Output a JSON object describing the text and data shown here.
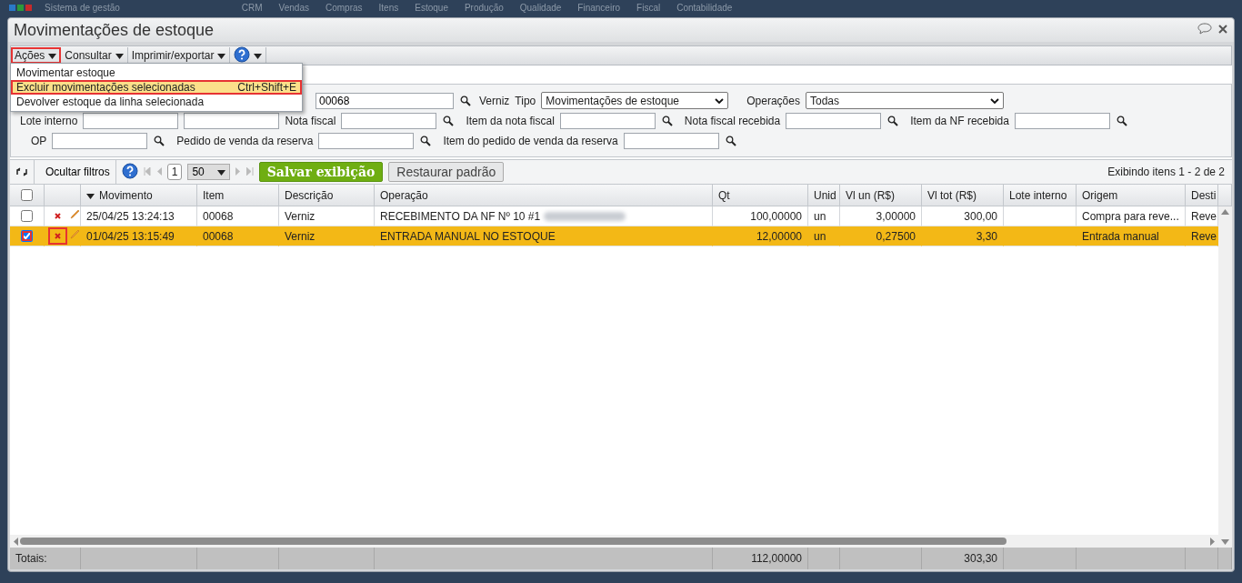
{
  "app": {
    "title": "Sistema de gestão",
    "menus": [
      "CRM",
      "Vendas",
      "Compras",
      "Itens",
      "Estoque",
      "Produção",
      "Qualidade",
      "Financeiro",
      "Fiscal",
      "Contabilidade"
    ]
  },
  "window": {
    "title": "Movimentações de estoque"
  },
  "toolbar": [
    {
      "kind": "menu",
      "label": "Ações",
      "highlighted": true,
      "expanded": true
    },
    {
      "kind": "menu",
      "label": "Consultar",
      "highlighted": false,
      "expanded": false
    },
    {
      "kind": "menu",
      "label": "Imprimir/exportar",
      "highlighted": false,
      "expanded": false
    },
    {
      "kind": "help",
      "highlighted": false,
      "expanded": false
    }
  ],
  "menu": [
    {
      "label": "Movimentar estoque",
      "selected": false,
      "highlighted": false
    },
    {
      "label": "Excluir movimentações selecionadas",
      "shortcut": "Ctrl+Shift+E",
      "selected": true,
      "highlighted": true
    },
    {
      "label": "Devolver estoque da linha selecionada",
      "selected": false,
      "highlighted": false
    }
  ],
  "filters": [
    [
      {
        "kind": "field",
        "value": "00068",
        "lookup": true,
        "hint": "Verniz"
      },
      {
        "kind": "select",
        "label": "Tipo",
        "value": "Movimentações de estoque"
      },
      {
        "kind": "select",
        "label": "Operações",
        "value": "Todas"
      }
    ],
    [
      {
        "kind": "field",
        "label": "Lote interno",
        "lookup": false
      },
      {
        "kind": "field",
        "lookup": false
      },
      {
        "kind": "field",
        "label": "Nota fiscal",
        "lookup": true
      },
      {
        "kind": "field",
        "label": "Item da nota fiscal",
        "lookup": true
      },
      {
        "kind": "field",
        "label": "Nota fiscal recebida",
        "lookup": true
      },
      {
        "kind": "field",
        "label": "Item da NF recebida",
        "lookup": true
      }
    ],
    [
      {
        "kind": "field",
        "label": "OP",
        "lookup": true
      },
      {
        "kind": "field",
        "label": "Pedido de venda da reserva",
        "lookup": true
      },
      {
        "kind": "field",
        "label": "Item do pedido de venda da reserva",
        "lookup": true
      }
    ]
  ],
  "grid_toolbar": {
    "hide_filters": "Ocultar filtros",
    "page": "1",
    "page_size": "50",
    "save": "Salvar exibição",
    "restore": "Restaurar padrão",
    "status": "Exibindo itens 1 - 2 de 2"
  },
  "select_all": {
    "checked": false
  },
  "columns": [
    {
      "label": "Movimento",
      "kind": "text",
      "sorted": true
    },
    {
      "label": "Item",
      "kind": "text",
      "sorted": false
    },
    {
      "label": "Descrição",
      "kind": "text",
      "sorted": false
    },
    {
      "label": "Operação",
      "kind": "text",
      "sorted": false
    },
    {
      "label": "Qt",
      "kind": "number",
      "sorted": false
    },
    {
      "label": "Unid",
      "kind": "text",
      "sorted": false
    },
    {
      "label": "Vl un (R$)",
      "kind": "number",
      "sorted": false
    },
    {
      "label": "Vl tot (R$)",
      "kind": "number",
      "sorted": false
    },
    {
      "label": "Lote interno",
      "kind": "text",
      "sorted": false
    },
    {
      "label": "Origem",
      "kind": "text",
      "sorted": false
    },
    {
      "label": "Desti",
      "kind": "text",
      "sorted": false
    }
  ],
  "rows": [
    {
      "checked": false,
      "selected": false,
      "marked": false,
      "redacted": true,
      "cells": [
        "25/04/25 13:24:13",
        "00068",
        "Verniz",
        "RECEBIMENTO DA NF Nº 10 #1",
        "100,00000",
        "un",
        "3,00000",
        "300,00",
        "",
        "Compra para reve...",
        "Reve"
      ]
    },
    {
      "checked": true,
      "selected": true,
      "marked": true,
      "redacted": false,
      "cells": [
        "01/04/25 13:15:49",
        "00068",
        "Verniz",
        "ENTRADA MANUAL NO ESTOQUE",
        "12,00000",
        "un",
        "0,27500",
        "3,30",
        "",
        "Entrada manual",
        "Reve"
      ]
    }
  ],
  "totals": {
    "label": "Totais:",
    "cells": [
      "",
      "",
      "",
      "",
      "112,00000",
      "",
      "",
      "303,30",
      "",
      "",
      ""
    ]
  }
}
